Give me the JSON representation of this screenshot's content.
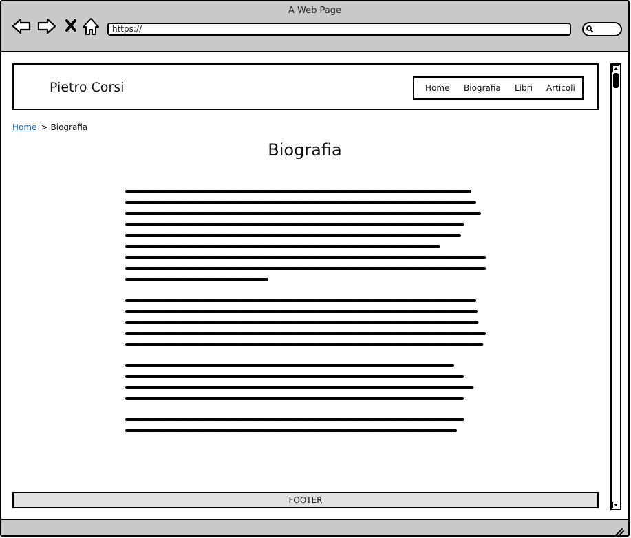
{
  "browser": {
    "title": "A Web Page",
    "url": "https://",
    "nav_icons": [
      "back-icon",
      "forward-icon",
      "stop-icon",
      "home-icon"
    ],
    "search_icon": "search-icon"
  },
  "site": {
    "brand": "Pietro Corsi",
    "menu": [
      {
        "label": "Home"
      },
      {
        "label": "Biografia"
      },
      {
        "label": "Libri"
      },
      {
        "label": "Articoli"
      }
    ]
  },
  "breadcrumb": {
    "home": "Home",
    "separator": ">",
    "current": "Biografia"
  },
  "page": {
    "title": "Biografia",
    "paragraphs": [
      {
        "lines": 9
      },
      {
        "lines": 5
      },
      {
        "lines": 4
      },
      {
        "lines": 2
      }
    ]
  },
  "footer": {
    "label": "FOOTER"
  }
}
